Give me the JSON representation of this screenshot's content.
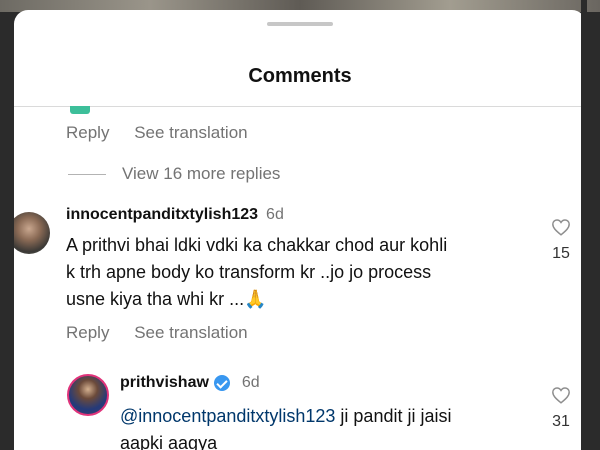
{
  "header": {
    "title": "Comments"
  },
  "thread_above": {
    "reply_label": "Reply",
    "translate_label": "See translation",
    "view_more_label": "View 16 more replies"
  },
  "comments": [
    {
      "username": "innocentpanditxtylish123",
      "time": "6d",
      "text_lines": [
        "A prithvi bhai ldki vdki ka chakkar chod aur kohli",
        "k trh apne body ko transform kr ..jo jo process",
        "usne kiya tha whi kr ...🙏"
      ],
      "likes": "15",
      "reply_label": "Reply",
      "translate_label": "See translation"
    },
    {
      "username": "prithvishaw",
      "verified": true,
      "time": "6d",
      "mention": "@innocentpanditxtylish123",
      "text_rest": " ji pandit ji jaisi",
      "text_line2": "aapki aagya",
      "likes": "31"
    }
  ],
  "icons": {
    "like": "heart-outline-icon",
    "verified": "verified-badge-icon"
  },
  "colors": {
    "muted": "#737373",
    "mention": "#00376b",
    "verified": "#3897f0",
    "story_ring": "#e0337a"
  }
}
